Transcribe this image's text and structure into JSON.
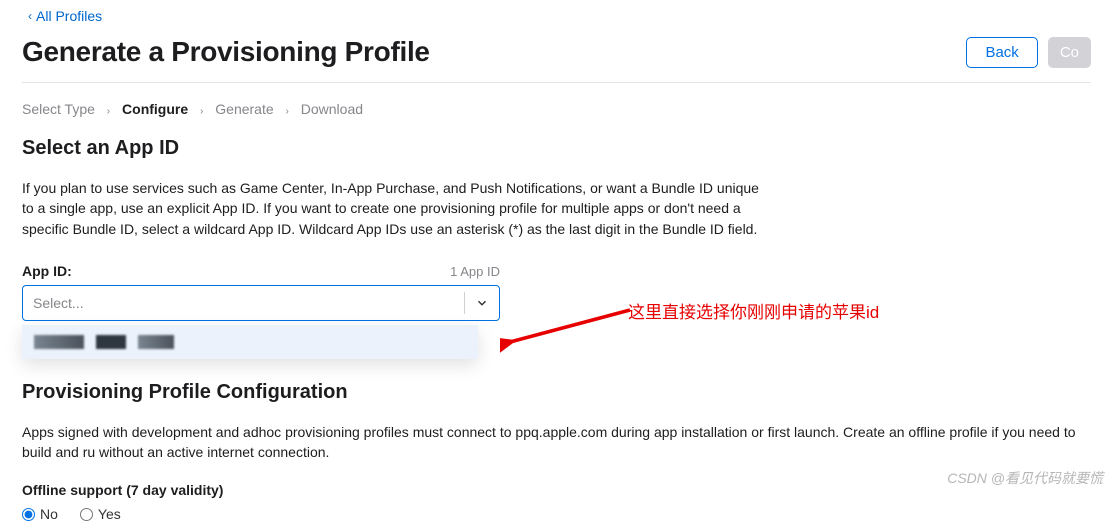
{
  "nav": {
    "back_link": "All Profiles"
  },
  "header": {
    "title": "Generate a Provisioning Profile",
    "back_btn": "Back",
    "continue_btn": "Co"
  },
  "breadcrumb": {
    "items": [
      "Select Type",
      "Configure",
      "Generate",
      "Download"
    ],
    "active_index": 1
  },
  "select_appid": {
    "title": "Select an App ID",
    "desc": "If you plan to use services such as Game Center, In-App Purchase, and Push Notifications, or want a Bundle ID unique to a single app, use an explicit App ID. If you want to create one provisioning profile for multiple apps or don't need a specific Bundle ID, select a wildcard App ID. Wildcard App IDs use an asterisk (*) as the last digit in the Bundle ID field.",
    "label": "App ID:",
    "count": "1 App ID",
    "placeholder": "Select..."
  },
  "annotation": {
    "text": "这里直接选择你刚刚申请的苹果id"
  },
  "config": {
    "title": "Provisioning Profile Configuration",
    "desc": "Apps signed with development and adhoc provisioning profiles must connect to ppq.apple.com during app installation or first launch. Create an offline profile if you need to build and ru without an active internet connection.",
    "offline_label": "Offline support (7 day validity)",
    "no": "No",
    "yes": "Yes"
  },
  "watermark": "CSDN @看见代码就要慌"
}
